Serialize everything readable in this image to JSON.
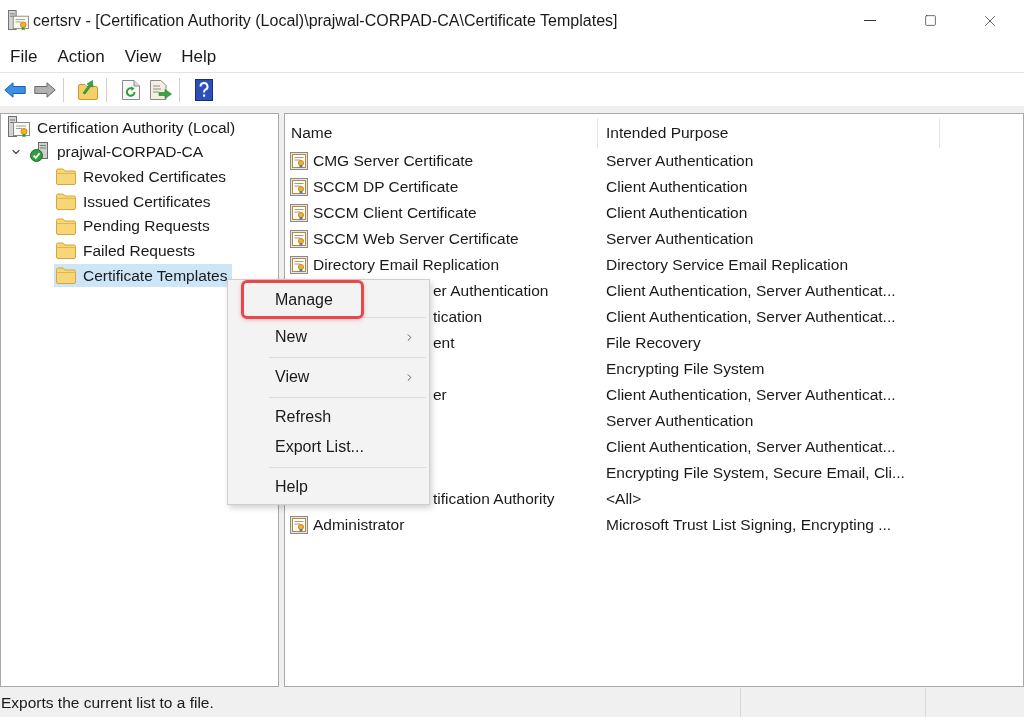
{
  "window": {
    "title": "certsrv - [Certification Authority (Local)\\prajwal-CORPAD-CA\\Certificate Templates]"
  },
  "menu_bar": [
    "File",
    "Action",
    "View",
    "Help"
  ],
  "toolbar": [
    [
      {
        "kind": "back",
        "disabled": false
      },
      {
        "kind": "forward",
        "disabled": true
      }
    ],
    [
      {
        "kind": "up",
        "disabled": false
      }
    ],
    [
      {
        "kind": "refresh",
        "disabled": false
      },
      {
        "kind": "export",
        "disabled": false
      }
    ],
    [
      {
        "kind": "help",
        "disabled": false
      }
    ]
  ],
  "tree": [
    {
      "label": "Certification Authority (Local)",
      "kind": "root",
      "selected": false,
      "children": [
        {
          "label": "prajwal-CORPAD-CA",
          "kind": "ca",
          "selected": false,
          "expanded": true,
          "children": [
            {
              "label": "Revoked Certificates",
              "kind": "folder",
              "selected": false
            },
            {
              "label": "Issued Certificates",
              "kind": "folder",
              "selected": false
            },
            {
              "label": "Pending Requests",
              "kind": "folder",
              "selected": false
            },
            {
              "label": "Failed Requests",
              "kind": "folder",
              "selected": false
            },
            {
              "label": "Certificate Templates",
              "kind": "folder",
              "selected": true
            }
          ]
        }
      ]
    }
  ],
  "list": {
    "columns": [
      "Name",
      "Intended Purpose"
    ],
    "rows": [
      {
        "kind": "full",
        "name": "CMG Server Certificate",
        "purpose": "Server Authentication"
      },
      {
        "kind": "full",
        "name": "SCCM DP Certificate",
        "purpose": "Client Authentication"
      },
      {
        "kind": "full",
        "name": "SCCM Client Certificate",
        "purpose": "Client Authentication"
      },
      {
        "kind": "full",
        "name": "SCCM Web Server Certificate",
        "purpose": "Server Authentication"
      },
      {
        "kind": "full",
        "name": "Directory Email Replication",
        "purpose": "Directory Service Email Replication"
      },
      {
        "kind": "cut",
        "name": "er Authentication",
        "purpose": "Client Authentication, Server Authenticat..."
      },
      {
        "kind": "cut",
        "name": "tication",
        "purpose": "Client Authentication, Server Authenticat..."
      },
      {
        "kind": "cut",
        "name": "ent",
        "purpose": "File Recovery"
      },
      {
        "kind": "cut",
        "purpose": "Encrypting File System"
      },
      {
        "kind": "cut",
        "name": "er",
        "purpose": "Client Authentication, Server Authenticat..."
      },
      {
        "kind": "cut",
        "purpose": "Server Authentication"
      },
      {
        "kind": "cut",
        "purpose": "Client Authentication, Server Authenticat..."
      },
      {
        "kind": "cut",
        "purpose": "Encrypting File System, Secure Email, Cli..."
      },
      {
        "kind": "cut",
        "name": "tification Authority",
        "purpose": "<All>"
      },
      {
        "kind": "full",
        "name": "Administrator",
        "purpose": "Microsoft Trust List Signing, Encrypting ..."
      }
    ]
  },
  "context_menu": {
    "groups": [
      [
        {
          "label": "Manage",
          "highlighted": true,
          "submenu": false
        }
      ],
      [
        {
          "label": "New",
          "highlighted": false,
          "submenu": true
        }
      ],
      [
        {
          "label": "View",
          "highlighted": false,
          "submenu": true
        }
      ],
      [
        {
          "label": "Refresh",
          "highlighted": false,
          "submenu": false
        },
        {
          "label": "Export List...",
          "highlighted": false,
          "submenu": false
        }
      ],
      [
        {
          "label": "Help",
          "highlighted": false,
          "submenu": false
        }
      ]
    ]
  },
  "status_bar": {
    "text": "Exports the current list to a file."
  }
}
